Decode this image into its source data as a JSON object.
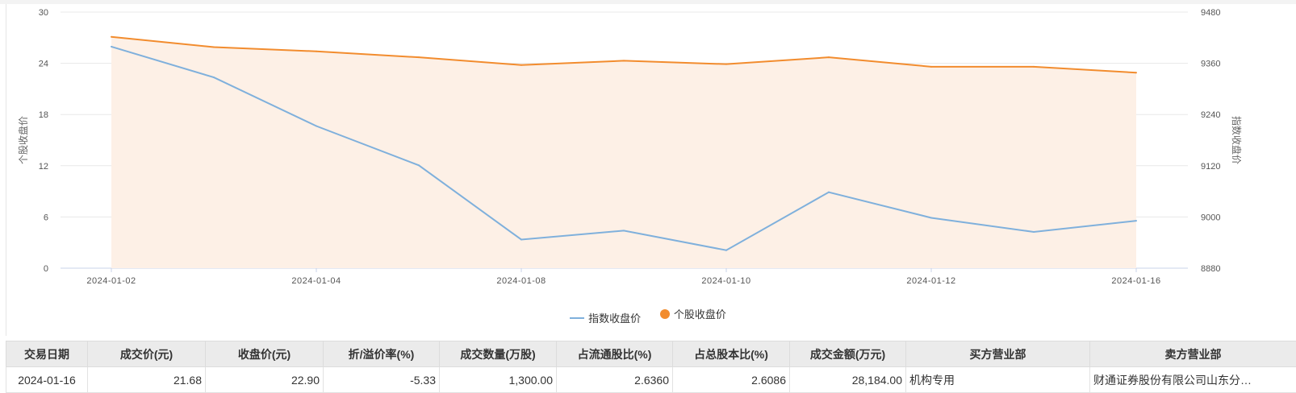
{
  "chart_data": {
    "type": "line",
    "x": [
      "2024-01-02",
      "2024-01-03",
      "2024-01-04",
      "2024-01-05",
      "2024-01-08",
      "2024-01-09",
      "2024-01-10",
      "2024-01-11",
      "2024-01-12",
      "2024-01-15",
      "2024-01-16"
    ],
    "xticks": [
      "2024-01-02",
      "2024-01-04",
      "2024-01-08",
      "2024-01-10",
      "2024-01-12",
      "2024-01-16"
    ],
    "series": [
      {
        "name": "指数收盘价",
        "axis": "right",
        "color": "#7fb0dc",
        "values": [
          9399,
          9327,
          9213,
          9121,
          8947,
          8968,
          8922,
          9058,
          8998,
          8965,
          8991
        ]
      },
      {
        "name": "个股收盘价",
        "axis": "left",
        "color": "#f28c2e",
        "fill": "#fdf0e6",
        "values": [
          27.1,
          25.9,
          25.4,
          24.7,
          23.8,
          24.3,
          23.9,
          24.7,
          23.6,
          23.6,
          22.9
        ]
      }
    ],
    "ylabel_left": "个股收盘价",
    "ylabel_right": "指数收盘价",
    "ylim_left": [
      0,
      30
    ],
    "ylim_right": [
      8880,
      9480
    ],
    "yticks_left": [
      0,
      6,
      12,
      18,
      24,
      30
    ],
    "yticks_right": [
      8880,
      9000,
      9120,
      9240,
      9360,
      9480
    ],
    "grid": true,
    "legend_position": "bottom"
  },
  "table": {
    "headers": [
      "交易日期",
      "成交价(元)",
      "收盘价(元)",
      "折/溢价率(%)",
      "成交数量(万股)",
      "占流通股比(%)",
      "占总股本比(%)",
      "成交金额(万元)",
      "买方营业部",
      "卖方营业部"
    ],
    "rows": [
      [
        "2024-01-16",
        "21.68",
        "22.90",
        "-5.33",
        "1,300.00",
        "2.6360",
        "2.6086",
        "28,184.00",
        "机构专用",
        "财通证券股份有限公司山东分…"
      ]
    ]
  }
}
